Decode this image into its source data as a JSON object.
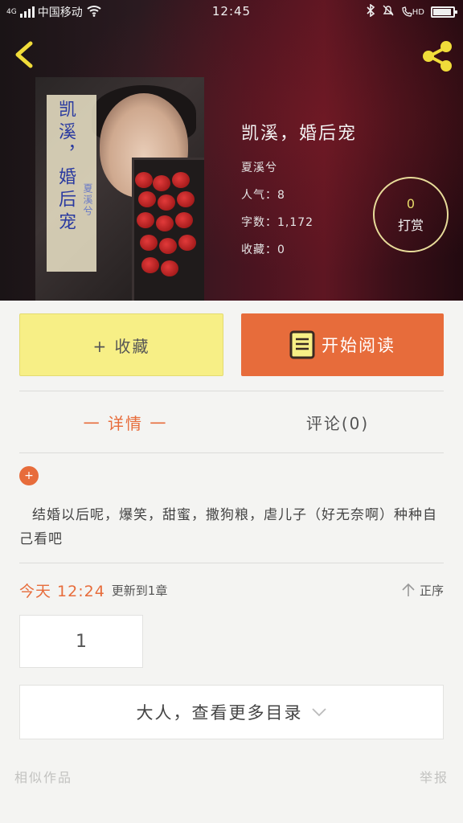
{
  "status_bar": {
    "network": "4G",
    "carrier": "中国移动",
    "time": "12:45",
    "hd": "HD"
  },
  "book": {
    "cover_title": "凯溪，婚后宠",
    "cover_author": "夏溪兮",
    "title": "凯溪，婚后宠",
    "author": "夏溪兮",
    "popularity": "人气：8",
    "word_count": "字数：1,172",
    "favorites": "收藏：0"
  },
  "tip": {
    "count": "0",
    "label": "打赏"
  },
  "actions": {
    "favorite_label": "+ 收藏",
    "read_label": "开始阅读"
  },
  "tabs": [
    {
      "label": "一 详情 一"
    },
    {
      "label": "评论(0)"
    }
  ],
  "expand_icon": "+",
  "description": "结婚以后呢，爆笑，甜蜜，撒狗粮，虐儿子（好无奈啊）种种自己看吧",
  "update": {
    "today": "今天 12:24",
    "text": "更新到1章"
  },
  "sort_label": "正序",
  "chapter": "1",
  "more_catalog": "大人，查看更多目录",
  "footer": {
    "similar": "相似作品",
    "report": "举报"
  },
  "colors": {
    "accent": "#e76c3b",
    "favorite_bg": "#f7ef86",
    "tip_ring": "#e8dc9a"
  }
}
